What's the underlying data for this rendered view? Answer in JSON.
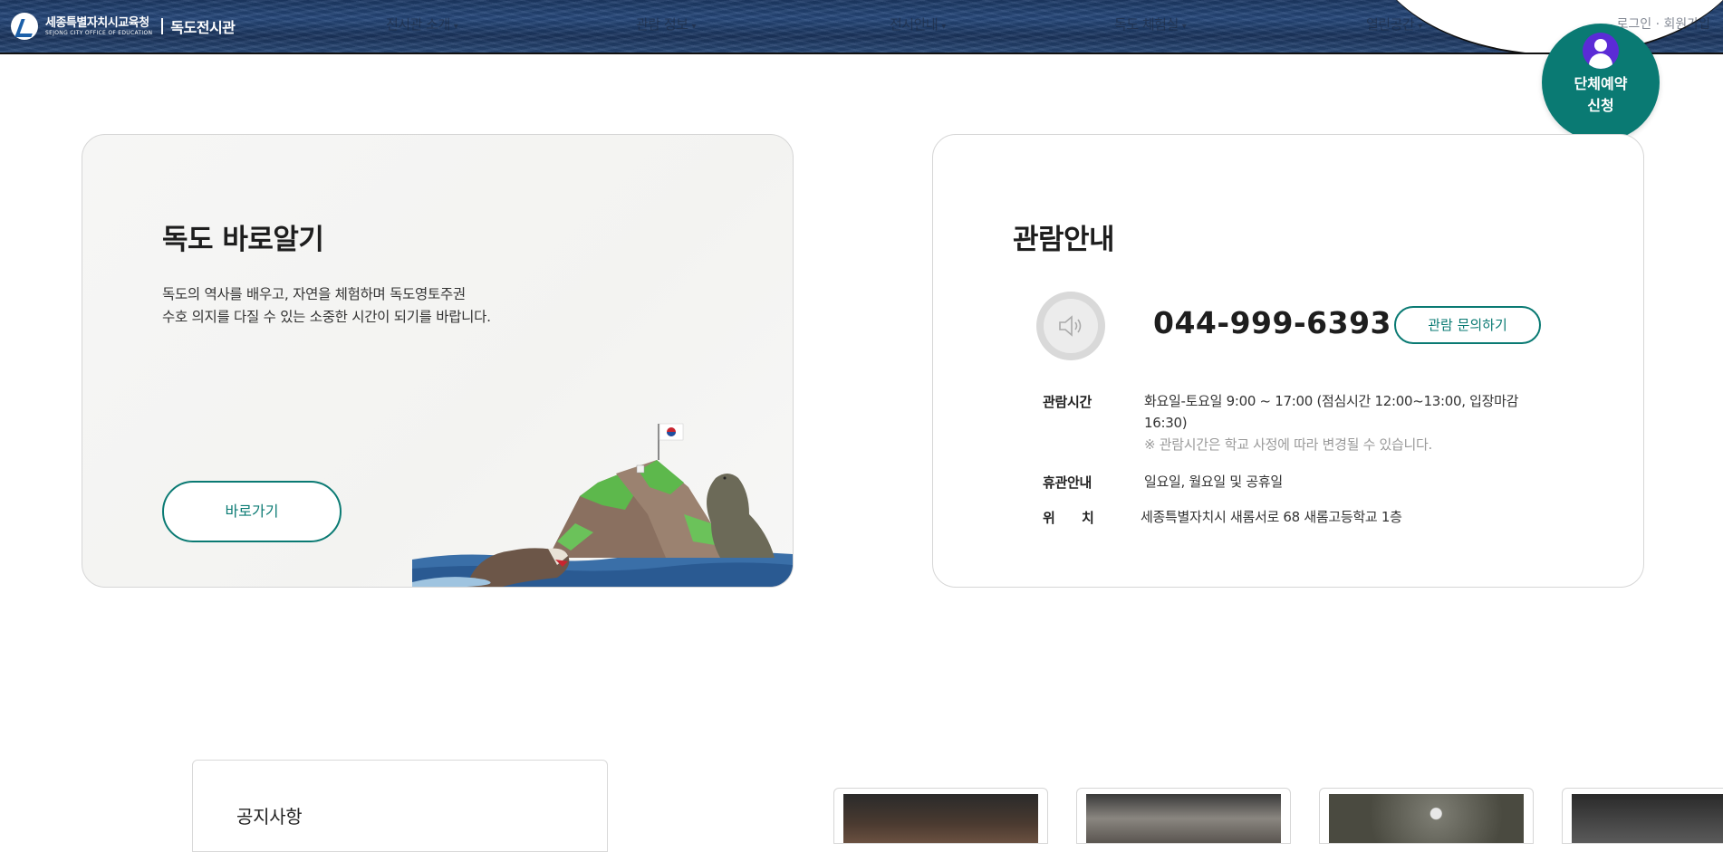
{
  "header": {
    "org_name": "세종특별자치시교육청",
    "org_name_en": "SEJONG CITY OFFICE OF EDUCATION",
    "site_name": "독도전시관",
    "menu": [
      {
        "label": "전시관 소개"
      },
      {
        "label": "관람 정보"
      },
      {
        "label": "전시안내"
      },
      {
        "label": "독도 체험실"
      },
      {
        "label": "열린공간"
      }
    ],
    "util_text": "로그인 · 회원가입"
  },
  "group_booking": {
    "label": "단체예약\n신청"
  },
  "dokdo_card": {
    "title": "독도 바로알기",
    "description": "독도의 역사를 배우고, 자연을 체험하며 독도영토주권\n수호 의지를 다질 수 있는 소중한 시간이 되기를 바랍니다.",
    "button_label": "바로가기"
  },
  "info_card": {
    "title": "관람안내",
    "phone": "044-999-6393",
    "inquiry_button": "관람 문의하기",
    "hours_label": "관람시간",
    "hours_line1": "화요일-토요일 9:00 ~ 17:00 (점심시간 12:00~13:00, 입장마감",
    "hours_line2": "16:30)",
    "hours_note": "※ 관람시간은 학교 사정에 따라 변경될 수 있습니다.",
    "closed_label": "휴관안내",
    "closed_value": "일요일, 월요일 및 공휴일",
    "location_label": "위      치",
    "location_value": "세종특별자치시 새롬서로 68 새롬고등학교 1층"
  },
  "notice": {
    "title": "공지사항"
  },
  "colors": {
    "accent": "#0a7a73",
    "header_bg": "#1d3a66",
    "avatar": "#5b2bd6"
  }
}
